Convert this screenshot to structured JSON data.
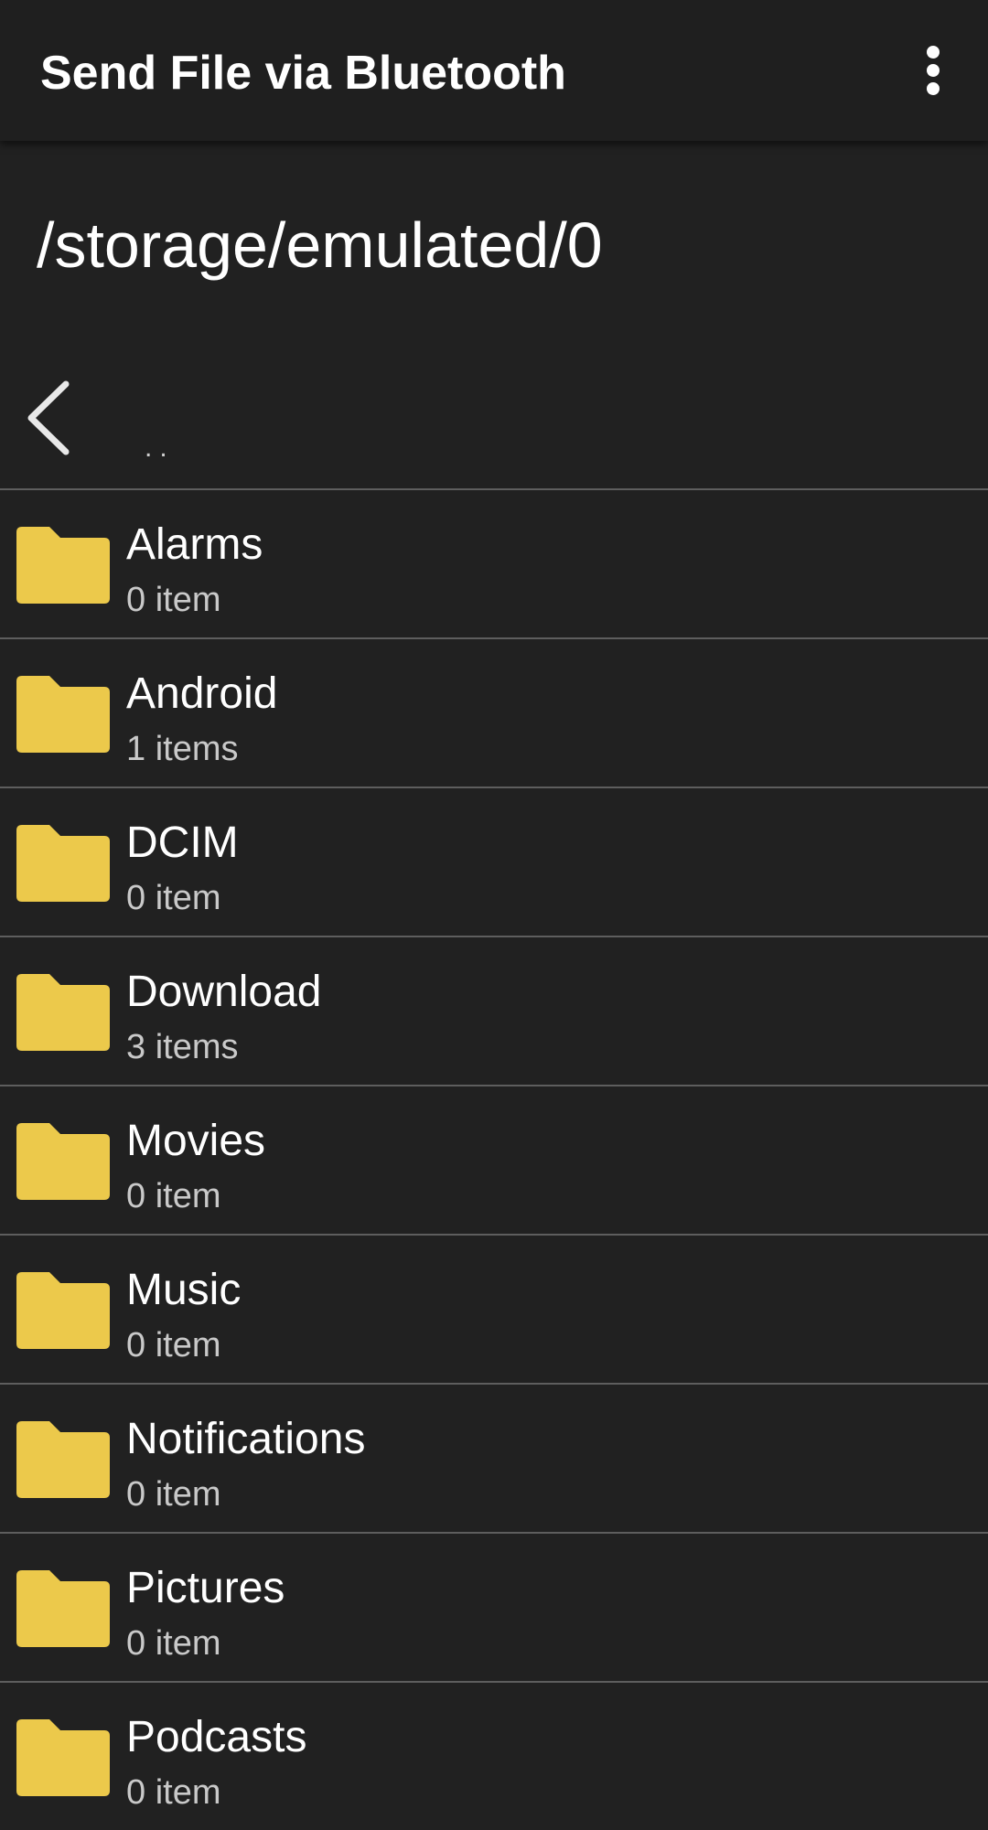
{
  "app_bar": {
    "title": "Send File via Bluetooth",
    "overflow_icon": "more-vert-icon"
  },
  "path": "/storage/emulated/0",
  "up_row": {
    "icon": "chevron-left-icon",
    "label": ".."
  },
  "colors": {
    "background": "#212121",
    "folder": "#ecc94b",
    "divider": "#5e5e5e"
  },
  "folders": [
    {
      "name": "Alarms",
      "count": "0 item"
    },
    {
      "name": "Android",
      "count": "1 items"
    },
    {
      "name": "DCIM",
      "count": "0 item"
    },
    {
      "name": "Download",
      "count": "3 items"
    },
    {
      "name": "Movies",
      "count": "0 item"
    },
    {
      "name": "Music",
      "count": "0 item"
    },
    {
      "name": "Notifications",
      "count": "0 item"
    },
    {
      "name": "Pictures",
      "count": "0 item"
    },
    {
      "name": "Podcasts",
      "count": "0 item"
    }
  ]
}
